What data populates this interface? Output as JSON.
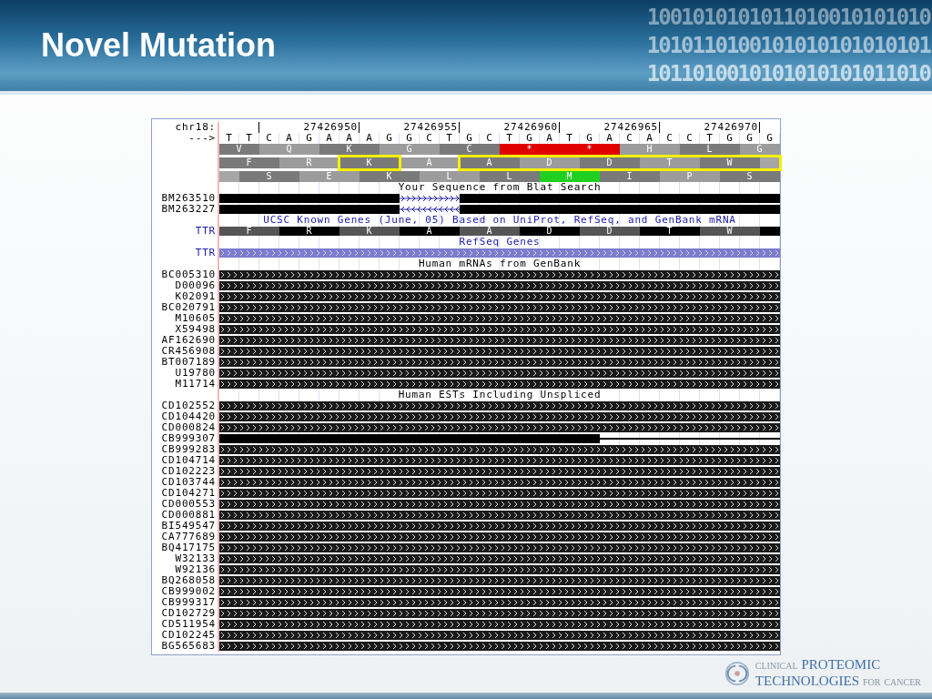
{
  "slide": {
    "title": "Novel Mutation",
    "binary_digits": [
      "1001010101011010010101010",
      "1010110100101010101010101",
      "1011010010101010101011010"
    ]
  },
  "browser": {
    "chrom_label": "chr18:",
    "strand_label": "--->",
    "ruler": [
      "27426950",
      "27426955",
      "27426960",
      "27426965",
      "27426970"
    ],
    "bases": [
      "T",
      "T",
      "C",
      "A",
      "G",
      "A",
      "A",
      "A",
      "G",
      "G",
      "C",
      "T",
      "G",
      "C",
      "T",
      "G",
      "A",
      "T",
      "G",
      "A",
      "C",
      "A",
      "C",
      "C",
      "T",
      "G",
      "G",
      "G"
    ],
    "frames": [
      [
        {
          "aa": "V",
          "color": "#7a7a7a"
        },
        {
          "aa": "Q",
          "color": "#9c9c9c"
        },
        {
          "aa": "K",
          "color": "#7a7a7a"
        },
        {
          "aa": "G",
          "color": "#9c9c9c"
        },
        {
          "aa": "C",
          "color": "#7a7a7a"
        },
        {
          "aa": "*",
          "color": "#e00000"
        },
        {
          "aa": "*",
          "color": "#e00000"
        },
        {
          "aa": "H",
          "color": "#9c9c9c"
        },
        {
          "aa": "L",
          "color": "#7a7a7a"
        },
        {
          "aa": "G",
          "color": "#9c9c9c"
        }
      ],
      [
        {
          "aa": "F",
          "color": "#7a7a7a",
          "highlighted": false
        },
        {
          "aa": "R",
          "color": "#9c9c9c",
          "highlighted": false
        },
        {
          "aa": "K",
          "color": "#7a7a7a",
          "highlighted": true
        },
        {
          "aa": "A",
          "color": "#9c9c9c",
          "highlighted": false
        },
        {
          "aa": "A",
          "color": "#7a7a7a",
          "highlighted": true
        },
        {
          "aa": "D",
          "color": "#9c9c9c",
          "highlighted": true
        },
        {
          "aa": "D",
          "color": "#7a7a7a",
          "highlighted": true
        },
        {
          "aa": "T",
          "color": "#9c9c9c",
          "highlighted": true
        },
        {
          "aa": "W",
          "color": "#7a7a7a",
          "highlighted": true
        }
      ],
      [
        {
          "aa": "S",
          "color": "#7a7a7a"
        },
        {
          "aa": "E",
          "color": "#9c9c9c"
        },
        {
          "aa": "K",
          "color": "#7a7a7a"
        },
        {
          "aa": "L",
          "color": "#9c9c9c"
        },
        {
          "aa": "L",
          "color": "#7a7a7a"
        },
        {
          "aa": "M",
          "color": "#20d020"
        },
        {
          "aa": "I",
          "color": "#7a7a7a"
        },
        {
          "aa": "P",
          "color": "#9c9c9c"
        },
        {
          "aa": "S",
          "color": "#7a7a7a"
        }
      ]
    ],
    "tracks": [
      {
        "kind": "header",
        "text": "Your Sequence from Blat Search",
        "color": "#000000"
      },
      {
        "kind": "blat",
        "label": "BM263510",
        "reverse": false
      },
      {
        "kind": "blat",
        "label": "BM263227",
        "reverse": true
      },
      {
        "kind": "header",
        "text": "UCSC Known Genes (June, 05) Based on UniProt, RefSeq, and GenBank mRNA",
        "color": "#1a1aa6"
      },
      {
        "kind": "gene",
        "label": "TTR",
        "aminos": [
          {
            "aa": "F",
            "color": "#555555"
          },
          {
            "aa": "R",
            "color": "#000000"
          },
          {
            "aa": "K",
            "color": "#555555"
          },
          {
            "aa": "A",
            "color": "#000000"
          },
          {
            "aa": "A",
            "color": "#555555"
          },
          {
            "aa": "D",
            "color": "#000000"
          },
          {
            "aa": "D",
            "color": "#555555"
          },
          {
            "aa": "T",
            "color": "#000000"
          },
          {
            "aa": "W",
            "color": "#555555"
          }
        ]
      },
      {
        "kind": "header",
        "text": "RefSeq Genes",
        "color": "#1a1aa6"
      },
      {
        "kind": "refseq",
        "label": "TTR"
      },
      {
        "kind": "header",
        "text": "Human mRNAs from GenBank",
        "color": "#000000"
      },
      {
        "kind": "alignment",
        "label": "BC005310"
      },
      {
        "kind": "alignment",
        "label": "D00096"
      },
      {
        "kind": "alignment",
        "label": "K02091"
      },
      {
        "kind": "alignment",
        "label": "BC020791"
      },
      {
        "kind": "alignment",
        "label": "M10605"
      },
      {
        "kind": "alignment",
        "label": "X59498"
      },
      {
        "kind": "alignment",
        "label": "AF162690"
      },
      {
        "kind": "alignment",
        "label": "CR456908"
      },
      {
        "kind": "alignment",
        "label": "BT007189"
      },
      {
        "kind": "alignment",
        "label": "U19780"
      },
      {
        "kind": "alignment",
        "label": "M11714"
      },
      {
        "kind": "header",
        "text": "Human ESTs Including Unspliced",
        "color": "#000000"
      },
      {
        "kind": "alignment",
        "label": "CD102552"
      },
      {
        "kind": "alignment",
        "label": "CD104420"
      },
      {
        "kind": "alignment",
        "label": "CD000824"
      },
      {
        "kind": "partial",
        "label": "CB999307"
      },
      {
        "kind": "alignment",
        "label": "CB999283"
      },
      {
        "kind": "alignment",
        "label": "CD104714"
      },
      {
        "kind": "alignment",
        "label": "CD102223"
      },
      {
        "kind": "alignment",
        "label": "CD103744"
      },
      {
        "kind": "alignment",
        "label": "CD104271"
      },
      {
        "kind": "alignment",
        "label": "CD000553"
      },
      {
        "kind": "alignment",
        "label": "CD000881"
      },
      {
        "kind": "alignment",
        "label": "BI549547"
      },
      {
        "kind": "alignment",
        "label": "CA777689"
      },
      {
        "kind": "alignment",
        "label": "BQ417175"
      },
      {
        "kind": "alignment",
        "label": "W32133"
      },
      {
        "kind": "alignment",
        "label": "W92136"
      },
      {
        "kind": "alignment",
        "label": "BQ268058"
      },
      {
        "kind": "alignment",
        "label": "CB999002"
      },
      {
        "kind": "alignment",
        "label": "CB999317"
      },
      {
        "kind": "alignment",
        "label": "CD102729"
      },
      {
        "kind": "alignment",
        "label": "CD511954"
      },
      {
        "kind": "alignment",
        "label": "CD102245"
      },
      {
        "kind": "alignment",
        "label": "BG565683"
      }
    ]
  },
  "logo": {
    "lines": [
      [
        {
          "text": "CLINICAL",
          "strong": false
        },
        {
          "text": "PROTEOMIC",
          "strong": true
        }
      ],
      [
        {
          "text": "TECHNOLOGIES",
          "strong": true
        },
        {
          "text": "FOR",
          "strong": false
        },
        {
          "text": "CANCER",
          "strong": false
        }
      ]
    ]
  }
}
